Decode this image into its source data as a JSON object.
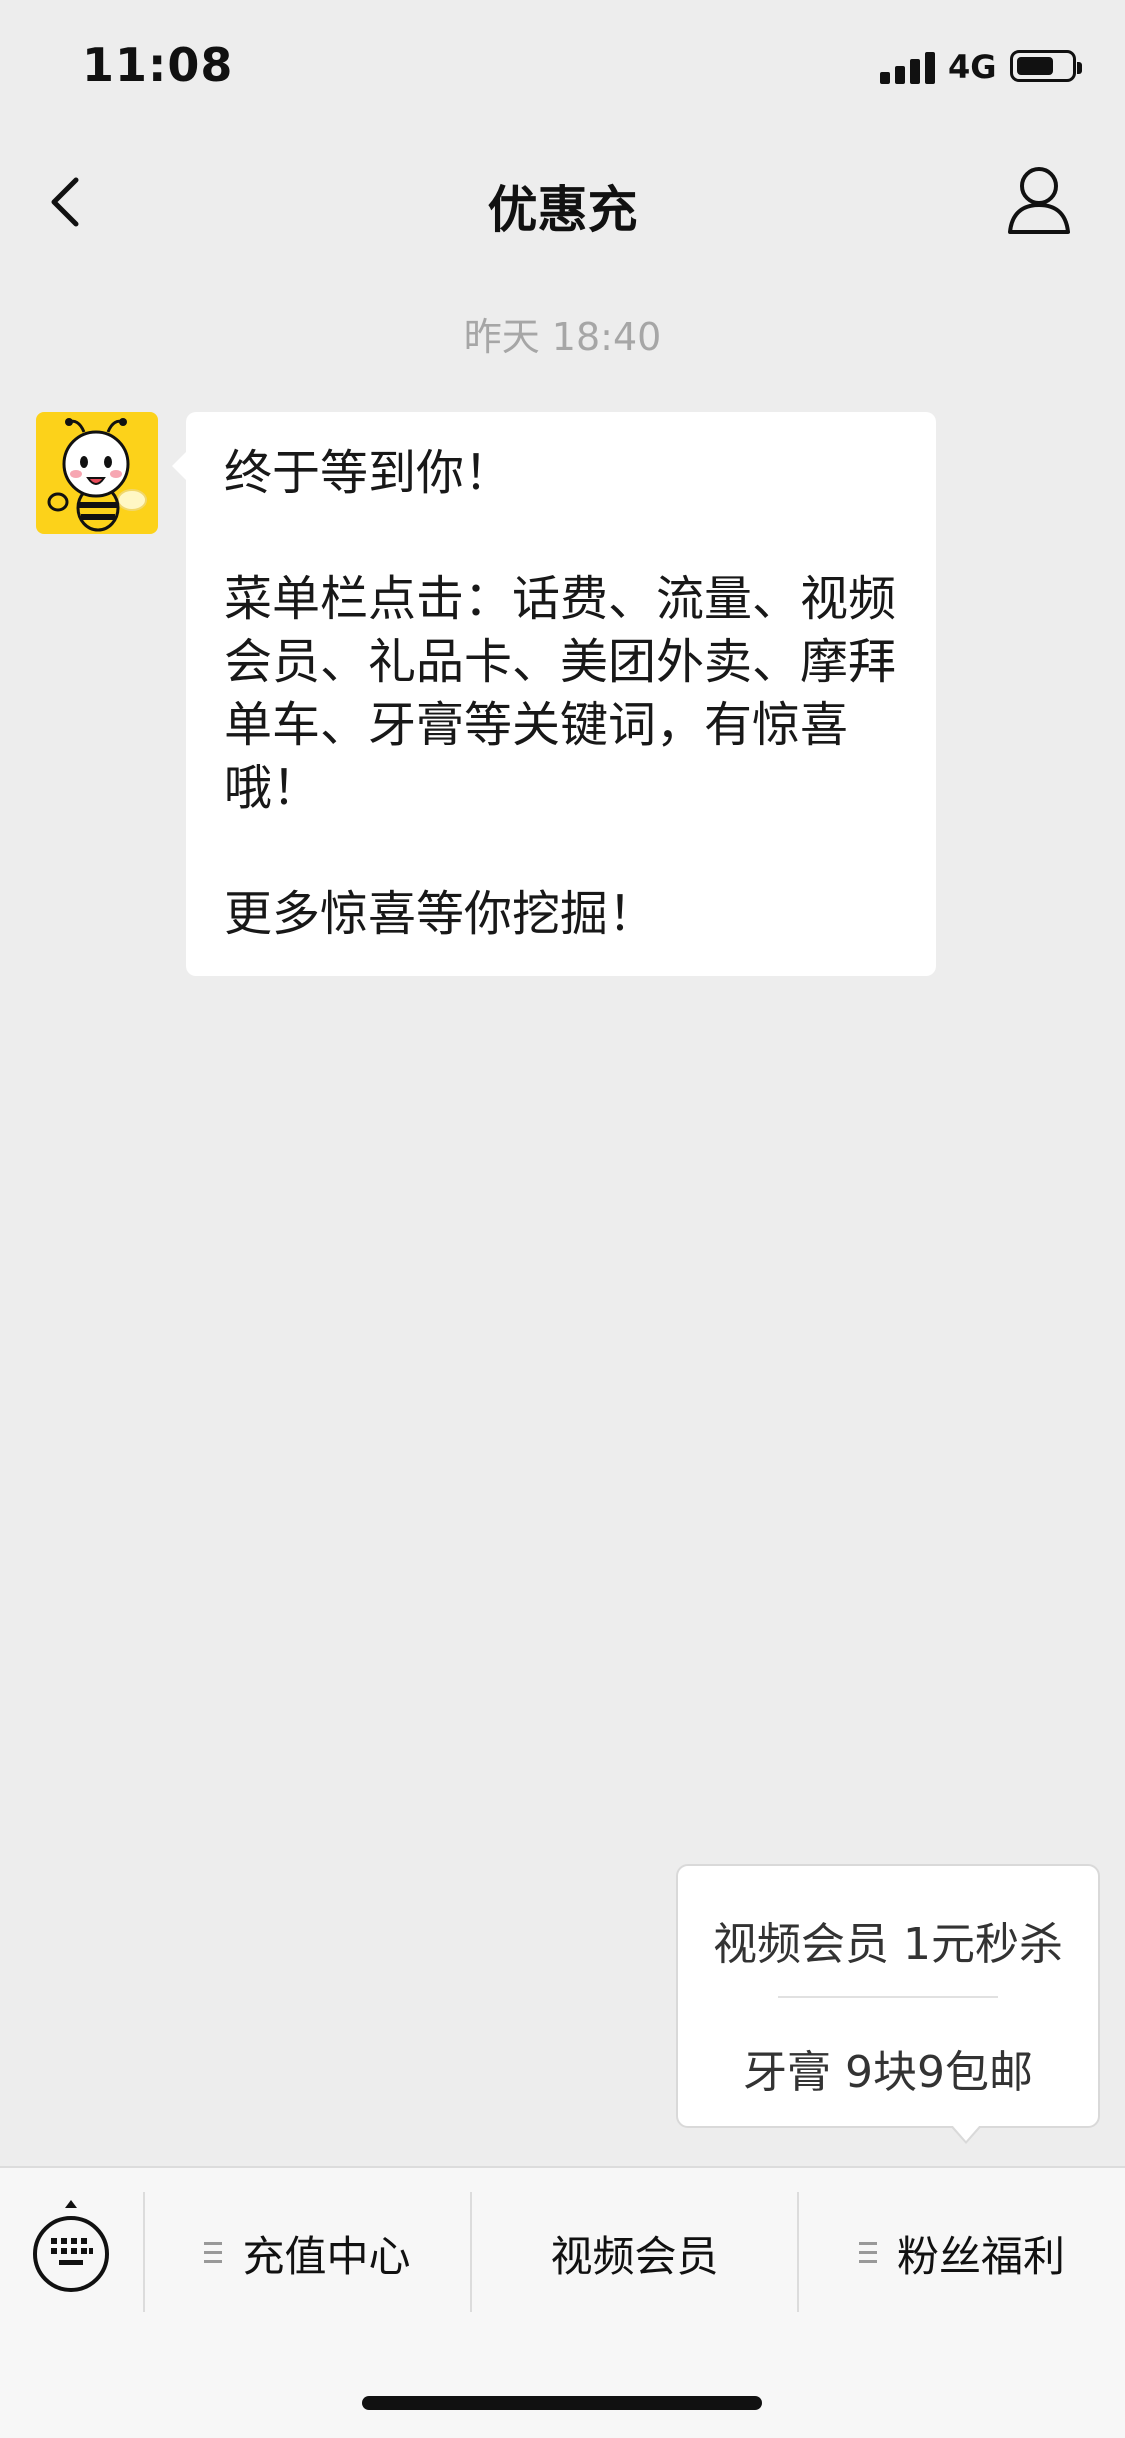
{
  "status_bar": {
    "time": "11:08",
    "network": "4G"
  },
  "nav": {
    "title": "优惠充"
  },
  "chat": {
    "timestamp": "昨天 18:40",
    "message": "终于等到你！\n\n菜单栏点击：话费、流量、视频会员、礼品卡、美团外卖、摩拜单车、牙膏等关键词，有惊喜哦！\n\n更多惊喜等你挖掘！"
  },
  "popup_menu": {
    "items": [
      "视频会员 1元秒杀",
      "牙膏 9块9包邮"
    ]
  },
  "bottom_menu": {
    "items": [
      "充值中心",
      "视频会员",
      "粉丝福利"
    ]
  },
  "colors": {
    "background": "#ededed",
    "avatar_bg": "#fcd21a",
    "bubble": "#ffffff"
  }
}
